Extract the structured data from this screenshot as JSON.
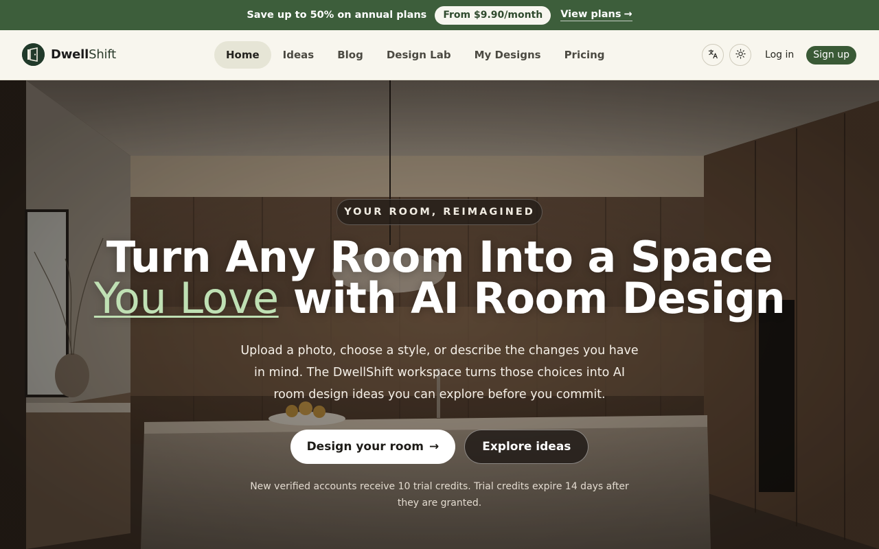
{
  "promo": {
    "text": "Save up to 50% on annual plans",
    "pill": "From $9.90/month",
    "link": "View plans",
    "link_arrow": "→"
  },
  "brand": {
    "name_bold": "Dwell",
    "name_rest": "Shift"
  },
  "nav": {
    "items": [
      {
        "label": "Home"
      },
      {
        "label": "Ideas"
      },
      {
        "label": "Blog"
      },
      {
        "label": "Design Lab"
      },
      {
        "label": "My Designs"
      },
      {
        "label": "Pricing"
      }
    ],
    "login": "Log in",
    "signup": "Sign up"
  },
  "icons": {
    "language": "language-icon",
    "theme": "sun-icon",
    "logo": "door-logo-icon"
  },
  "hero": {
    "eyebrow": "YOUR ROOM, REIMAGINED",
    "headline_line1": "Turn Any Room Into a Space",
    "headline_accent": "You Love",
    "headline_line2_rest": " with AI Room Design",
    "subtitle": "Upload a photo, choose a style, or describe the changes you have in mind. The DwellShift workspace turns those choices into AI room design ideas you can explore before you commit.",
    "primary_cta": "Design your room",
    "primary_cta_arrow": "→",
    "secondary_cta": "Explore ideas",
    "note": "New verified accounts receive 10 trial credits. Trial credits expire 14 days after they are granted."
  },
  "colors": {
    "promo_bg": "#3d5e3b",
    "nav_bg": "#f8f6ee",
    "accent_green": "#bfe0b4",
    "signup_bg": "#3a5a36"
  }
}
